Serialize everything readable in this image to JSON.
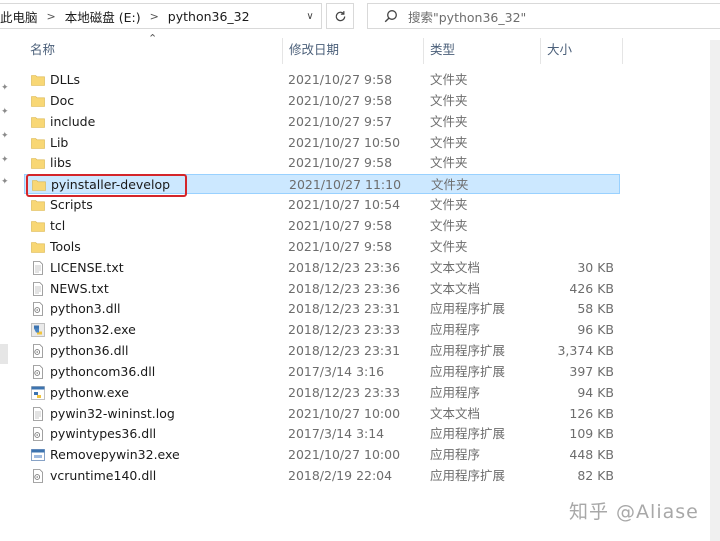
{
  "address_bar": {
    "crumbs": [
      "此电脑",
      "本地磁盘 (E:)",
      "python36_32"
    ]
  },
  "search": {
    "placeholder": "搜索\"python36_32\""
  },
  "columns": {
    "name": "名称",
    "date": "修改日期",
    "type": "类型",
    "size": "大小"
  },
  "files": [
    {
      "name": "DLLs",
      "date": "2021/10/27 9:58",
      "type": "文件夹",
      "size": "",
      "icon": "folder-icon"
    },
    {
      "name": "Doc",
      "date": "2021/10/27 9:58",
      "type": "文件夹",
      "size": "",
      "icon": "folder-icon"
    },
    {
      "name": "include",
      "date": "2021/10/27 9:57",
      "type": "文件夹",
      "size": "",
      "icon": "folder-icon"
    },
    {
      "name": "Lib",
      "date": "2021/10/27 10:50",
      "type": "文件夹",
      "size": "",
      "icon": "folder-icon"
    },
    {
      "name": "libs",
      "date": "2021/10/27 9:58",
      "type": "文件夹",
      "size": "",
      "icon": "folder-icon"
    },
    {
      "name": "pyinstaller-develop",
      "date": "2021/10/27 11:10",
      "type": "文件夹",
      "size": "",
      "icon": "folder-icon"
    },
    {
      "name": "Scripts",
      "date": "2021/10/27 10:54",
      "type": "文件夹",
      "size": "",
      "icon": "folder-icon"
    },
    {
      "name": "tcl",
      "date": "2021/10/27 9:58",
      "type": "文件夹",
      "size": "",
      "icon": "folder-icon"
    },
    {
      "name": "Tools",
      "date": "2021/10/27 9:58",
      "type": "文件夹",
      "size": "",
      "icon": "folder-icon"
    },
    {
      "name": "LICENSE.txt",
      "date": "2018/12/23 23:36",
      "type": "文本文档",
      "size": "30 KB",
      "icon": "text-file-icon"
    },
    {
      "name": "NEWS.txt",
      "date": "2018/12/23 23:36",
      "type": "文本文档",
      "size": "426 KB",
      "icon": "text-file-icon"
    },
    {
      "name": "python3.dll",
      "date": "2018/12/23 23:31",
      "type": "应用程序扩展",
      "size": "58 KB",
      "icon": "dll-file-icon"
    },
    {
      "name": "python32.exe",
      "date": "2018/12/23 23:33",
      "type": "应用程序",
      "size": "96 KB",
      "icon": "python-exe-icon"
    },
    {
      "name": "python36.dll",
      "date": "2018/12/23 23:31",
      "type": "应用程序扩展",
      "size": "3,374 KB",
      "icon": "dll-file-icon"
    },
    {
      "name": "pythoncom36.dll",
      "date": "2017/3/14 3:16",
      "type": "应用程序扩展",
      "size": "397 KB",
      "icon": "dll-file-icon"
    },
    {
      "name": "pythonw.exe",
      "date": "2018/12/23 23:33",
      "type": "应用程序",
      "size": "94 KB",
      "icon": "pythonw-exe-icon"
    },
    {
      "name": "pywin32-wininst.log",
      "date": "2021/10/27 10:00",
      "type": "文本文档",
      "size": "126 KB",
      "icon": "text-file-icon"
    },
    {
      "name": "pywintypes36.dll",
      "date": "2017/3/14 3:14",
      "type": "应用程序扩展",
      "size": "109 KB",
      "icon": "dll-file-icon"
    },
    {
      "name": "Removepywin32.exe",
      "date": "2021/10/27 10:00",
      "type": "应用程序",
      "size": "448 KB",
      "icon": "installer-exe-icon"
    },
    {
      "name": "vcruntime140.dll",
      "date": "2018/2/19 22:04",
      "type": "应用程序扩展",
      "size": "82 KB",
      "icon": "dll-file-icon"
    }
  ],
  "selected_index": 5,
  "watermark": "知乎 @Aliase",
  "colors": {
    "selection_bg": "#cce8ff",
    "selection_border": "#99d1ff",
    "highlight_box": "#d4252a",
    "folder": "#f8d775",
    "header_text": "#4c607a"
  }
}
